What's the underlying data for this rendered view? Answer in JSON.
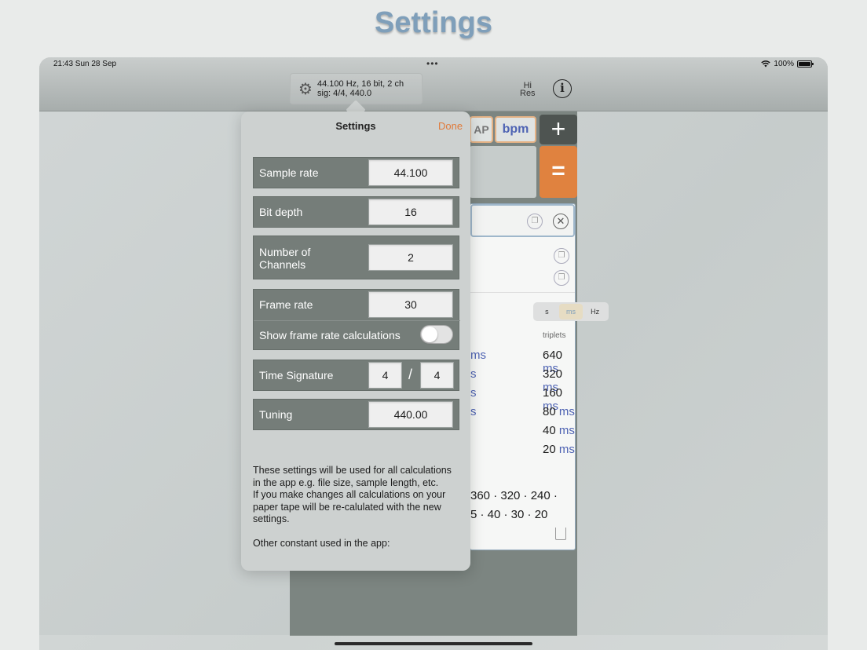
{
  "page_title": "Settings",
  "status": {
    "time_date": "21:43  Sun 28 Sep",
    "dots": "•••",
    "battery": "100%"
  },
  "toolbar": {
    "info_line1": "44.100 Hz, 16 bit, 2 ch",
    "info_line2": "sig: 4/4, 440.0",
    "hires_line1": "Hi",
    "hires_line2": "Res",
    "info_button": "i"
  },
  "calculator": {
    "tap_label": "AP",
    "bpm_label": "bpm",
    "plus_label": "+",
    "equals_label": "=",
    "segment": [
      "s",
      "ms",
      "Hz"
    ],
    "segment_selected": "ms",
    "triplets_label": "triplets",
    "triplets": [
      {
        "value": "640",
        "unit": "ms"
      },
      {
        "value": "320",
        "unit": "ms"
      },
      {
        "value": "160",
        "unit": "ms"
      },
      {
        "value": "80",
        "unit": "ms"
      },
      {
        "value": "40",
        "unit": "ms"
      },
      {
        "value": "20",
        "unit": "ms"
      }
    ],
    "left_fragments": [
      "ms",
      "s",
      "s",
      "s"
    ],
    "sequence_line1": "360 · 320 · 240 ·",
    "sequence_line2": "5 · 40 · 30 · 20"
  },
  "settings": {
    "title": "Settings",
    "done": "Done",
    "sample_rate_label": "Sample rate",
    "sample_rate_value": "44.100",
    "bit_depth_label": "Bit depth",
    "bit_depth_value": "16",
    "channels_label_1": "Number of",
    "channels_label_2": "Channels",
    "channels_value": "2",
    "frame_rate_label": "Frame rate",
    "frame_rate_value": "30",
    "show_frame_calc_label": "Show frame rate calculations",
    "show_frame_calc_on": false,
    "time_sig_label": "Time Signature",
    "time_sig_num": "4",
    "time_sig_sep": "/",
    "time_sig_den": "4",
    "tuning_label": "Tuning",
    "tuning_value": "440.00",
    "description_1": "These settings will be used for all calculations in the app e.g. file size, sample length, etc.",
    "description_2": "If you make changes all calculations on your paper tape will be re-calulated with the new settings.",
    "description_3": "Other constant used in the app:"
  },
  "colors": {
    "accent_orange": "#e0823f",
    "accent_blue": "#4e63b3",
    "title_blue": "#7f9fba"
  }
}
